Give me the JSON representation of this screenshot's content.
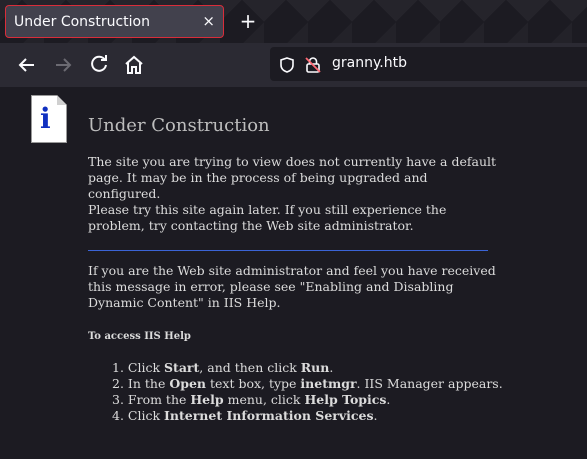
{
  "browser": {
    "tab_title": "Under Construction",
    "tab_close": "×",
    "new_tab": "+",
    "url": "granny.htb"
  },
  "page": {
    "heading": "Under Construction",
    "para1": "The site you are trying to view does not currently have a default page. It may be in the process of being upgraded and configured.",
    "para2": "Please try this site again later. If you still experience the problem, try contacting the Web site administrator.",
    "para3": "If you are the Web site administrator and feel you have received this message in error, please see \"Enabling and Disabling Dynamic Content\" in IIS Help.",
    "help_heading": "To access IIS Help",
    "steps": [
      {
        "num": "1.",
        "a": "Click ",
        "b1": "Start",
        "c": ", and then click ",
        "b2": "Run",
        "d": "."
      },
      {
        "num": "2.",
        "a": "In the ",
        "b1": "Open",
        "c": " text box, type ",
        "b2": "inetmgr",
        "d": ". IIS Manager appears."
      },
      {
        "num": "3.",
        "a": "From the ",
        "b1": "Help",
        "c": " menu, click ",
        "b2": "Help Topics",
        "d": "."
      },
      {
        "num": "4.",
        "a": "Click ",
        "b1": "Internet Information Services",
        "c": "",
        "b2": "",
        "d": "."
      }
    ]
  }
}
